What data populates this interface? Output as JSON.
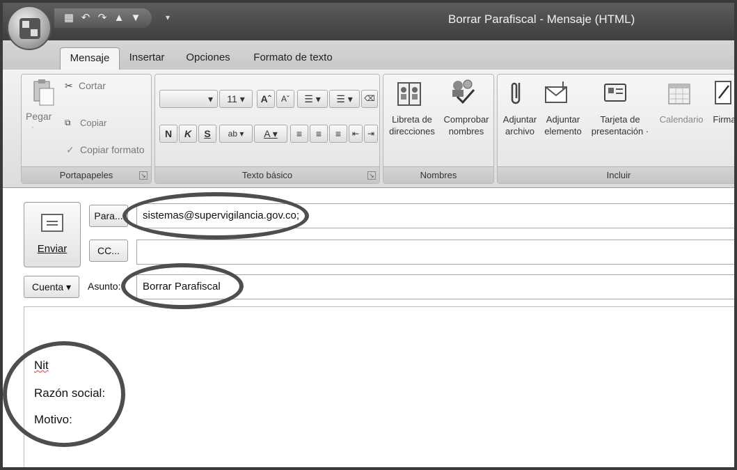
{
  "window": {
    "title": "Borrar Parafiscal - Mensaje (HTML)"
  },
  "quick_access": {
    "icons": [
      "save-icon",
      "undo-icon",
      "redo-icon",
      "up-arrow-icon",
      "down-arrow-icon",
      "customize-icon"
    ]
  },
  "tabs": [
    {
      "label": "Mensaje",
      "active": true
    },
    {
      "label": "Insertar",
      "active": false
    },
    {
      "label": "Opciones",
      "active": false
    },
    {
      "label": "Formato de texto",
      "active": false
    }
  ],
  "ribbon": {
    "clipboard": {
      "label": "Portapapeles",
      "paste": "Pegar",
      "cut": "Cortar",
      "copy": "Copiar",
      "format_painter": "Copiar formato"
    },
    "basic_text": {
      "label": "Texto básico",
      "font_size": "11",
      "bold": "N",
      "italic": "K",
      "underline": "S"
    },
    "names": {
      "label": "Nombres",
      "address_book": [
        "Libreta de",
        "direcciones"
      ],
      "check_names": [
        "Comprobar",
        "nombres"
      ]
    },
    "include": {
      "label": "Incluir",
      "attach_file": [
        "Adjuntar",
        "archivo"
      ],
      "attach_item": [
        "Adjuntar",
        "elemento"
      ],
      "business_card": [
        "Tarjeta de",
        "presentación ·"
      ],
      "calendar": "Calendario",
      "signature": "Firma"
    }
  },
  "header": {
    "send": "Enviar",
    "to_button": "Para...",
    "cc_button": "CC...",
    "to_value": "sistemas@supervigilancia.gov.co;",
    "cc_value": "",
    "account_button": "Cuenta ▾",
    "subject_label": "Asunto:",
    "subject_value": "Borrar Parafiscal"
  },
  "body": {
    "lines": [
      "Nit",
      "Razón social:",
      "Motivo:"
    ]
  },
  "colors": {
    "title_bar": "#4a4a4a",
    "tab_strip": "#cfcfcf",
    "ribbon": "#e8e8e8",
    "annotation": "#4e4e4e"
  }
}
